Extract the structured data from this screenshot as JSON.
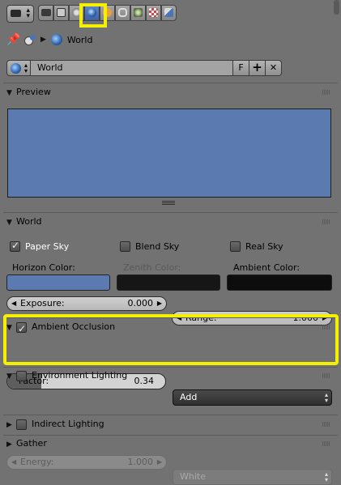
{
  "tabs": [
    "render-icon",
    "scene-icon",
    "layers-icon",
    "world-icon",
    "object-icon",
    "constraints-icon",
    "modifiers-icon",
    "material-icon",
    "texture-icon"
  ],
  "breadcrumb": {
    "label": "World"
  },
  "datablock": {
    "name": "World",
    "fake_user": "F",
    "add": "+",
    "remove": "✕"
  },
  "preview": {
    "title": "Preview",
    "color": "#5b7ab0"
  },
  "world": {
    "title": "World",
    "paper_sky": "Paper Sky",
    "blend_sky": "Blend Sky",
    "real_sky": "Real Sky",
    "horizon_label": "Horizon Color:",
    "zenith_label": "Zenith Color:",
    "ambient_label": "Ambient Color:",
    "horizon_color": "#5b7ab0",
    "zenith_color": "#161616",
    "ambient_color": "#0d0d0d",
    "exposure_label": "Exposure:",
    "exposure_value": "0.000",
    "range_label": "Range:",
    "range_value": "1.000"
  },
  "ambient_occlusion": {
    "title": "Ambient Occlusion",
    "factor_label": "Factor:",
    "factor_value": "0.34",
    "factor_fraction": 0.34,
    "blend_mode": "Add"
  },
  "environment_lighting": {
    "title": "Environment Lighting",
    "energy_label": "Energy:",
    "energy_value": "1.000",
    "source": "White"
  },
  "indirect_lighting": {
    "title": "Indirect Lighting"
  },
  "gather": {
    "title": "Gather"
  }
}
